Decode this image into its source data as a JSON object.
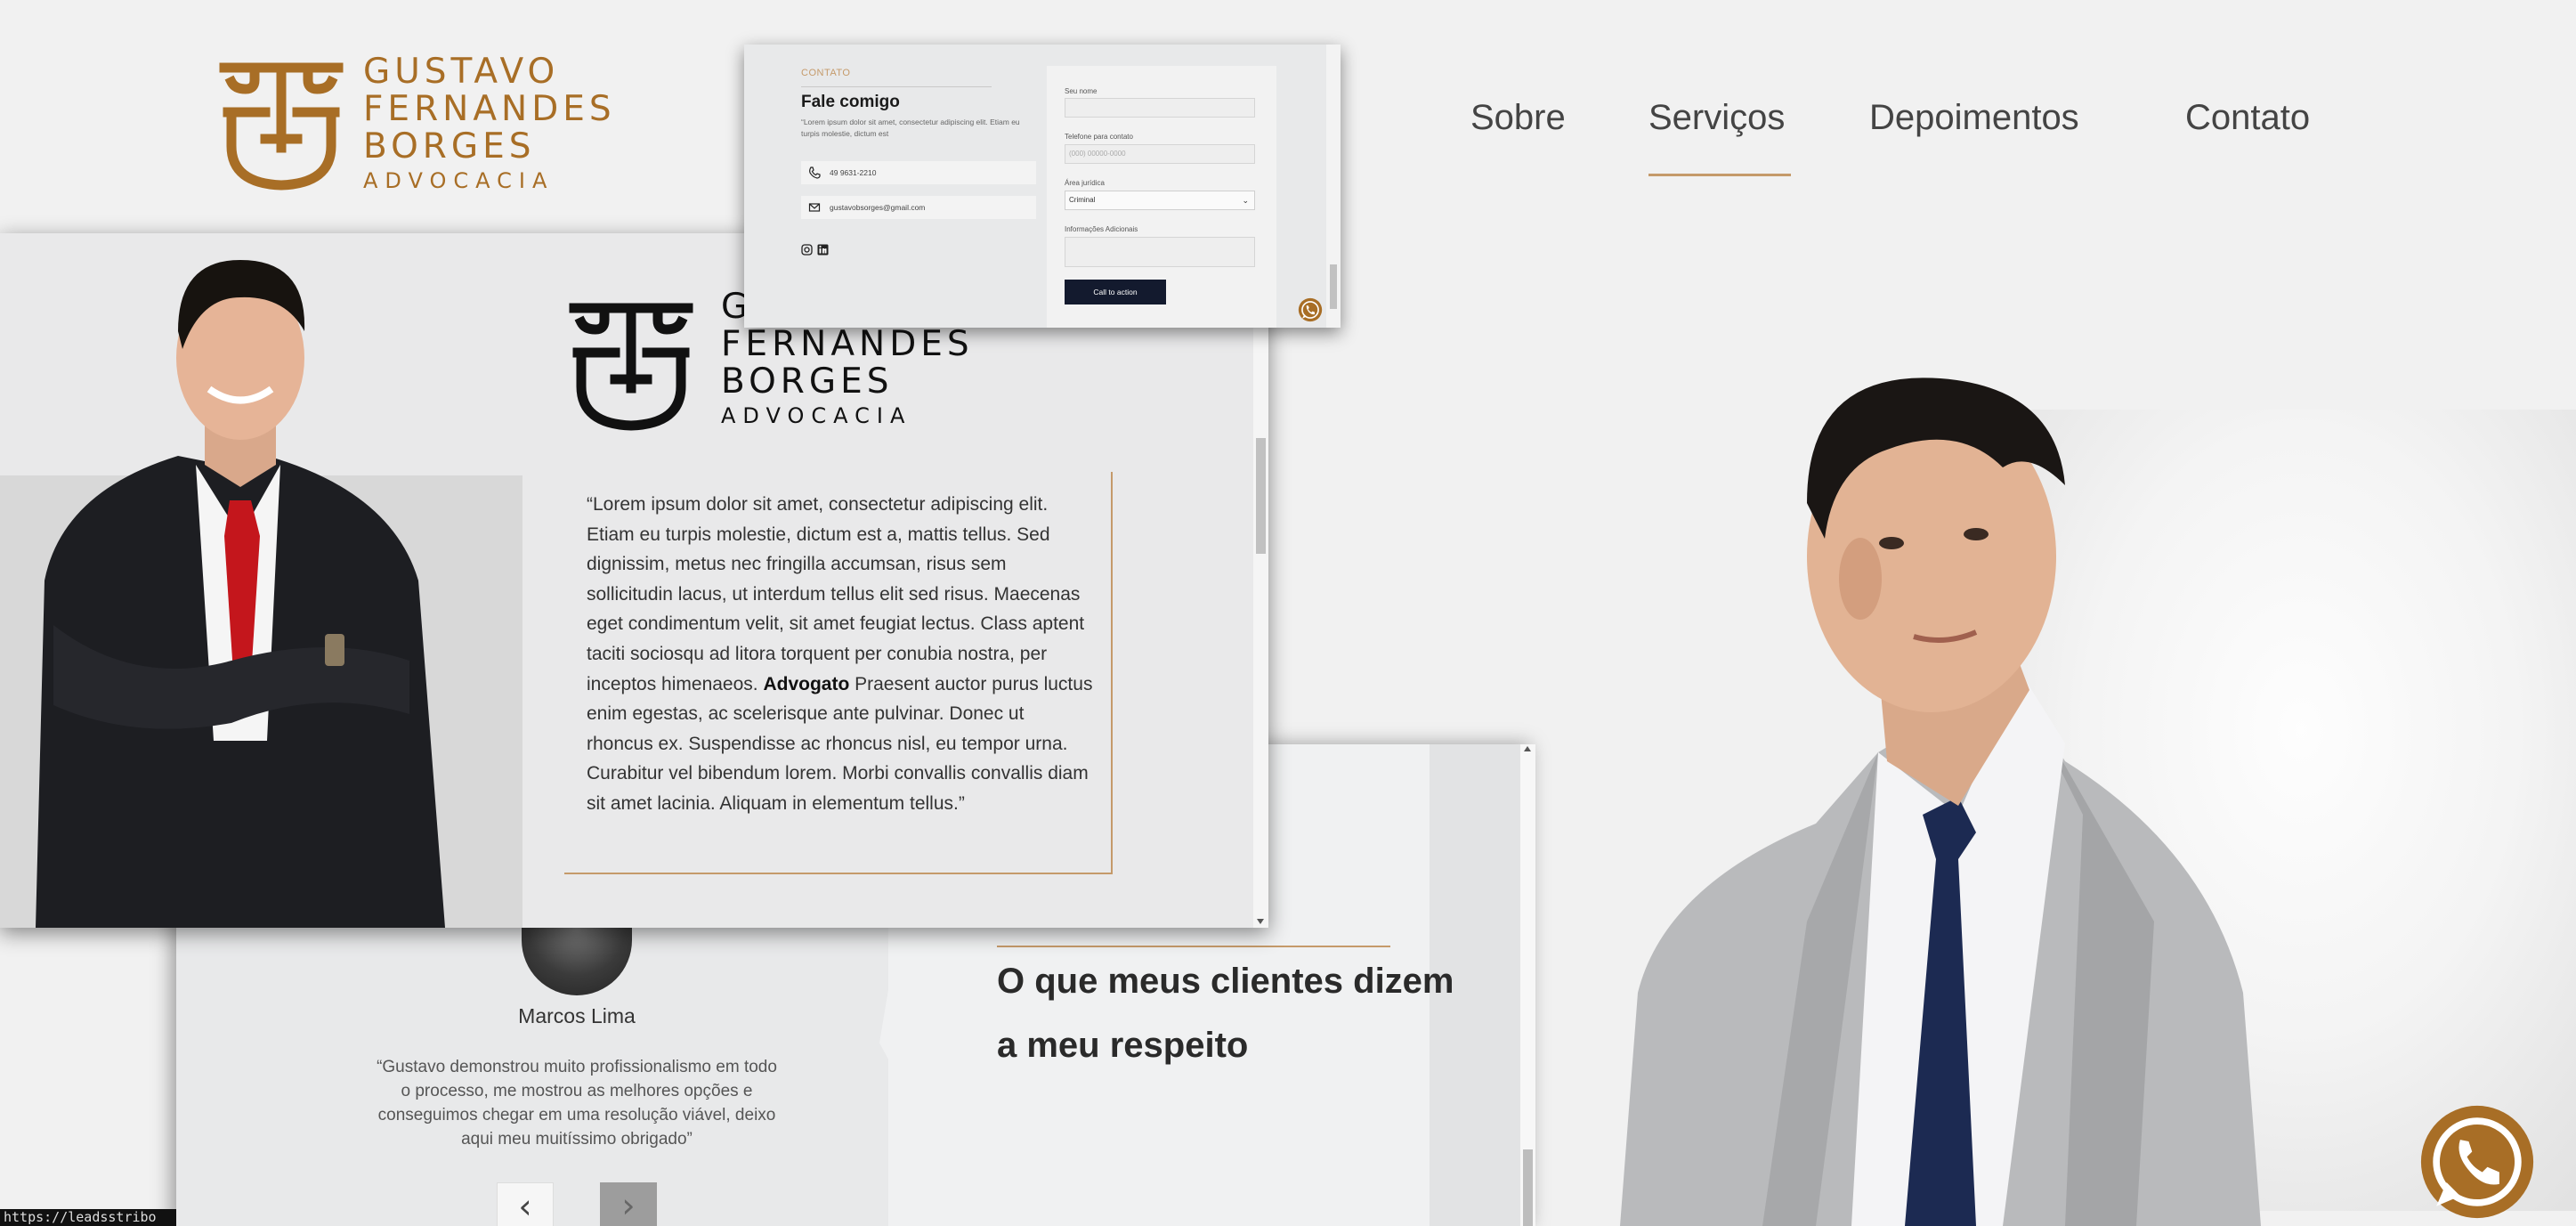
{
  "brand": {
    "line1": "GUSTAVO",
    "line2": "FERNANDES",
    "line3": "BORGES",
    "sub": "ADVOCACIA",
    "gold": "#a86e26",
    "accent": "#c59a6a",
    "navy": "#131a2e"
  },
  "nav": {
    "items": [
      {
        "label": "Sobre"
      },
      {
        "label": "Serviços"
      },
      {
        "label": "Depoimentos"
      },
      {
        "label": "Contato"
      }
    ],
    "active": "Serviços"
  },
  "about": {
    "logo_line1": "G",
    "logo_line2": "FERNANDES",
    "logo_line3": "BORGES",
    "logo_sub": "ADVOCACIA",
    "quote_before": "“Lorem ipsum dolor sit amet, consectetur adipiscing elit. Etiam eu turpis molestie, dictum est a, mattis tellus. Sed dignissim, metus nec fringilla accumsan, risus sem sollicitudin lacus, ut interdum tellus elit sed risus. Maecenas eget condimentum velit, sit amet feugiat lectus. Class aptent taciti sociosqu ad litora torquent per conubia nostra, per inceptos himenaeos. ",
    "quote_bold": "Advogato",
    "quote_after": " Praesent auctor purus luctus enim egestas, ac scelerisque ante pulvinar. Donec ut rhoncus ex. Suspendisse ac rhoncus nisl, eu tempor urna. Curabitur vel bibendum lorem. Morbi convallis convallis diam sit amet lacinia. Aliquam in elementum tellus.”"
  },
  "contact": {
    "kicker": "CONTATO",
    "title": "Fale comigo",
    "lead": "“Lorem ipsum dolor sit amet, consectetur adipiscing elit. Etiam eu turpis molestie, dictum est",
    "phone": "49 9631-2210",
    "email": "gustavobsorges@gmail.com",
    "form": {
      "name_label": "Seu nome",
      "name_value": "",
      "phone_label": "Telefone para contato",
      "phone_placeholder": "(000) 00000-0000",
      "area_label": "Área jurídica",
      "area_value": "Criminal",
      "info_label": "Informações Adicionais",
      "cta_label": "Call to action"
    }
  },
  "testimonials": {
    "reviewer_name": "Marcos Lima",
    "reviewer_quote": "“Gustavo demonstrou muito profissionalismo em todo o processo, me mostrou as melhores opções e conseguimos chegar em uma resolução viável, deixo aqui meu muitíssimo obrigado”",
    "prev": "‹",
    "next": "›",
    "section_title": "O que meus clientes dizem a meu respeito"
  },
  "status_url": "https://leadsstribo"
}
